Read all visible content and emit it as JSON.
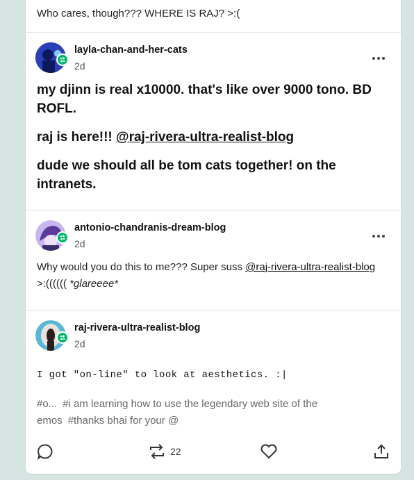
{
  "top_post": {
    "text": "Who cares, though??? WHERE IS RAJ? >:("
  },
  "posts": [
    {
      "username": "layla-chan-and-her-cats",
      "time": "2d",
      "paragraphs": [
        "my djinn is real x10000. that's like over 9000 tono. BD ROFL.",
        "raj is here!!! ",
        "dude we should all be tom cats together! on the intranets."
      ],
      "mention": "@raj-rivera-ultra-realist-blog"
    },
    {
      "username": "antonio-chandranis-dream-blog",
      "time": "2d",
      "text_before": "Why would you do this to me??? Super suss ",
      "mention": "@raj-rivera-ultra-realist-blog",
      "text_after": " >:(((((( ",
      "italic": "*glareeee*"
    },
    {
      "username": "raj-rivera-ultra-realist-blog",
      "time": "2d",
      "mono_text": "I got \"on-line\" to look at aesthetics. :|"
    }
  ],
  "tags": [
    "#o...",
    "#i am learning how to use the legendary web site of the emos",
    "#thanks bhai for your @"
  ],
  "footer": {
    "reblog_count": "22"
  },
  "icons": {
    "reblog_badge": "reblog-icon",
    "more": "more-options-icon",
    "reply": "reply-icon",
    "reblog": "reblog-icon",
    "like": "heart-icon",
    "share": "share-icon"
  },
  "colors": {
    "background": "#d6e5e1",
    "reblog_green": "#00b86b"
  }
}
